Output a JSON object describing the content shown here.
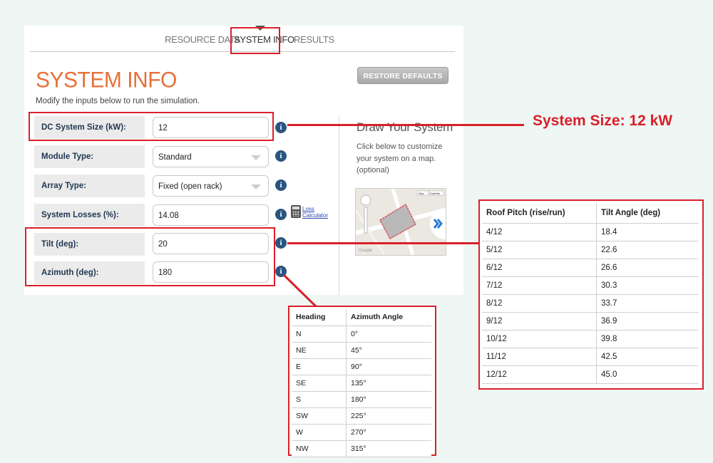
{
  "tabs": [
    {
      "label": "RESOURCE DATA"
    },
    {
      "label": "SYSTEM INFO"
    },
    {
      "label": "RESULTS"
    }
  ],
  "page": {
    "title": "SYSTEM INFO",
    "subtitle": "Modify the inputs below to run the simulation.",
    "restore_label": "RESTORE DEFAULTS"
  },
  "form": {
    "dc_size": {
      "label": "DC System Size (kW):",
      "value": "12"
    },
    "module_type": {
      "label": "Module Type:",
      "value": "Standard"
    },
    "array_type": {
      "label": "Array Type:",
      "value": "Fixed (open rack)"
    },
    "losses": {
      "label": "System Losses (%):",
      "value": "14.08"
    },
    "tilt": {
      "label": "Tilt (deg):",
      "value": "20"
    },
    "azimuth": {
      "label": "Azimuth (deg):",
      "value": "180"
    },
    "loss_calc_line1": "Loss",
    "loss_calc_line2": "Calculator",
    "info_glyph": "i"
  },
  "draw": {
    "title": "Draw Your System",
    "desc": "Click below to customize your system on a map. (optional)",
    "map_btn1": "Map",
    "map_btn2": "Satellite",
    "map_logo": "Google"
  },
  "annotation": {
    "system_size": "System Size: 12 kW"
  },
  "pitch_table": {
    "headers": [
      "Roof Pitch (rise/run)",
      "Tilt Angle (deg)"
    ],
    "rows": [
      [
        "4/12",
        "18.4"
      ],
      [
        "5/12",
        "22.6"
      ],
      [
        "6/12",
        "26.6"
      ],
      [
        "7/12",
        "30.3"
      ],
      [
        "8/12",
        "33.7"
      ],
      [
        "9/12",
        "36.9"
      ],
      [
        "10/12",
        "39.8"
      ],
      [
        "11/12",
        "42.5"
      ],
      [
        "12/12",
        "45.0"
      ]
    ]
  },
  "azimuth_table": {
    "headers": [
      "Heading",
      "Azimuth Angle"
    ],
    "rows": [
      [
        "N",
        "0°"
      ],
      [
        "NE",
        "45°"
      ],
      [
        "E",
        "90°"
      ],
      [
        "SE",
        "135°"
      ],
      [
        "S",
        "180°"
      ],
      [
        "SW",
        "225°"
      ],
      [
        "W",
        "270°"
      ],
      [
        "NW",
        "315°"
      ]
    ]
  },
  "colors": {
    "accent_red": "#d9202a",
    "title_orange": "#e8703a",
    "info_blue": "#2a5580"
  }
}
